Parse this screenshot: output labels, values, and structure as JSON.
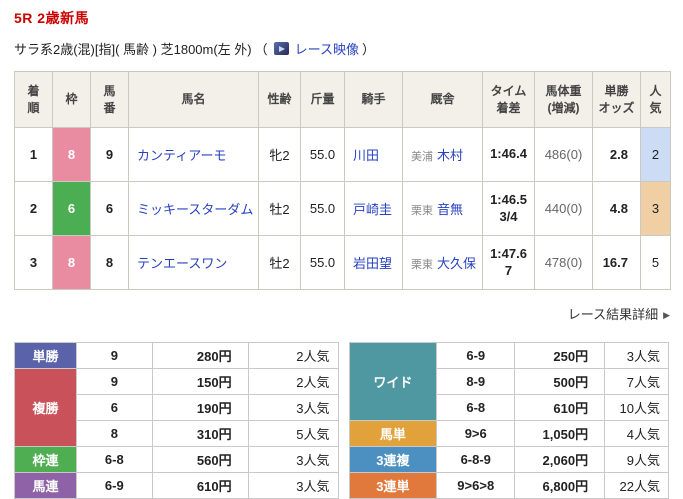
{
  "header": {
    "race_title": "5R 2歳新馬",
    "conditions": "サラ系2歳(混)[指]( 馬齢 ) 芝1800m(左 外)",
    "paren_open": "（",
    "video_label": "レース映像",
    "paren_close": "）"
  },
  "results": {
    "headers": {
      "rank": "着順",
      "frame": "枠",
      "horse_no": "馬番",
      "name": "馬名",
      "sex_age": "性齢",
      "weight": "斤量",
      "jockey": "騎手",
      "stable": "厩舎",
      "time_l1": "タイム",
      "time_l2": "着差",
      "hweight_l1": "馬体重",
      "hweight_l2": "(増減)",
      "odds_l1": "単勝",
      "odds_l2": "オッズ",
      "popularity": "人気"
    },
    "rows": [
      {
        "rank": "1",
        "frame": "8",
        "horse_no": "9",
        "name": "カンティアーモ",
        "sex_age": "牝2",
        "weight": "55.0",
        "jockey": "川田",
        "stable_region": "美浦",
        "trainer": "木村",
        "time": "1:46.4",
        "margin": "",
        "horse_weight": "486(0)",
        "odds": "2.8",
        "popularity": "2"
      },
      {
        "rank": "2",
        "frame": "6",
        "horse_no": "6",
        "name": "ミッキースターダム",
        "sex_age": "牡2",
        "weight": "55.0",
        "jockey": "戸崎圭",
        "stable_region": "栗東",
        "trainer": "音無",
        "time": "1:46.5",
        "margin": "3/4",
        "horse_weight": "440(0)",
        "odds": "4.8",
        "popularity": "3"
      },
      {
        "rank": "3",
        "frame": "8",
        "horse_no": "8",
        "name": "テンエースワン",
        "sex_age": "牡2",
        "weight": "55.0",
        "jockey": "岩田望",
        "stable_region": "栗東",
        "trainer": "大久保",
        "time": "1:47.6",
        "margin": "7",
        "horse_weight": "478(0)",
        "odds": "16.7",
        "popularity": "5"
      }
    ],
    "detail_link": "レース結果詳細",
    "detail_arrow": "▶"
  },
  "payouts_left": [
    {
      "label": "単勝",
      "combo": "9",
      "amount": "280円",
      "pop": "2人気"
    },
    {
      "label": "複勝",
      "combo": "9",
      "amount": "150円",
      "pop": "2人気"
    },
    {
      "combo": "6",
      "amount": "190円",
      "pop": "3人気"
    },
    {
      "combo": "8",
      "amount": "310円",
      "pop": "5人気"
    },
    {
      "label": "枠連",
      "combo": "6-8",
      "amount": "560円",
      "pop": "3人気"
    },
    {
      "label": "馬連",
      "combo": "6-9",
      "amount": "610円",
      "pop": "3人気"
    }
  ],
  "payouts_right": [
    {
      "label": "ワイド",
      "combo": "6-9",
      "amount": "250円",
      "pop": "3人気"
    },
    {
      "combo": "8-9",
      "amount": "500円",
      "pop": "7人気"
    },
    {
      "combo": "6-8",
      "amount": "610円",
      "pop": "10人気"
    },
    {
      "label": "馬単",
      "combo": "9>6",
      "amount": "1,050円",
      "pop": "4人気"
    },
    {
      "label": "3連複",
      "combo": "6-8-9",
      "amount": "2,060円",
      "pop": "9人気"
    },
    {
      "label": "3連単",
      "combo": "9>6>8",
      "amount": "6,800円",
      "pop": "22人気"
    }
  ],
  "colors": {
    "title_red": "#cc0000",
    "link_blue": "#2742c0",
    "frame_8_pink": "#e98ba1",
    "frame_6_green": "#4cae52",
    "popularity_2_bg": "#ccdcf5",
    "popularity_3_bg": "#f0cfa4",
    "table_header_bg": "#f3f0ea",
    "tansho": "#5a63a9",
    "fukusho": "#c9525a",
    "wakuren": "#4fae52",
    "umaren": "#8f62a8",
    "wide": "#4f98a2",
    "umatan": "#e2a23b",
    "sanrenpuku": "#4b90c0",
    "sanrentan": "#e2793c"
  }
}
